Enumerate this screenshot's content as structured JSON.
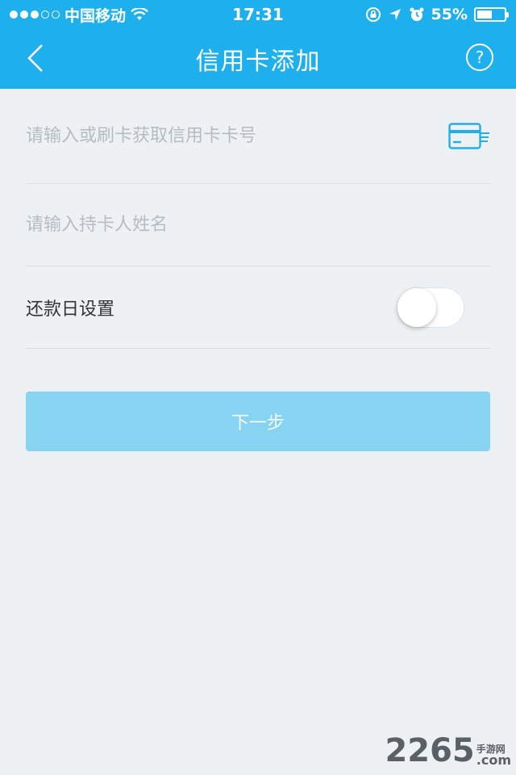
{
  "status_bar": {
    "carrier": "中国移动",
    "time": "17:31",
    "battery": "55%",
    "battery_level": 0.55
  },
  "nav": {
    "title": "信用卡添加",
    "back_icon": "back-chevron-icon",
    "help_label": "?"
  },
  "form": {
    "card_number_placeholder": "请输入或刷卡获取信用卡卡号",
    "card_icon": "credit-card-icon",
    "holder_name_placeholder": "请输入持卡人姓名",
    "repayment_label": "还款日设置",
    "repayment_toggle_on": false
  },
  "next_button": {
    "label": "下一步"
  },
  "watermark": {
    "number": "2265",
    "cn_text": "手游网",
    "com_text": ".com"
  },
  "colors": {
    "header_bg": "#1eb0ec",
    "page_bg": "#eef1f4",
    "button_bg": "#86d3f2",
    "card_icon": "#1eb0ec"
  }
}
